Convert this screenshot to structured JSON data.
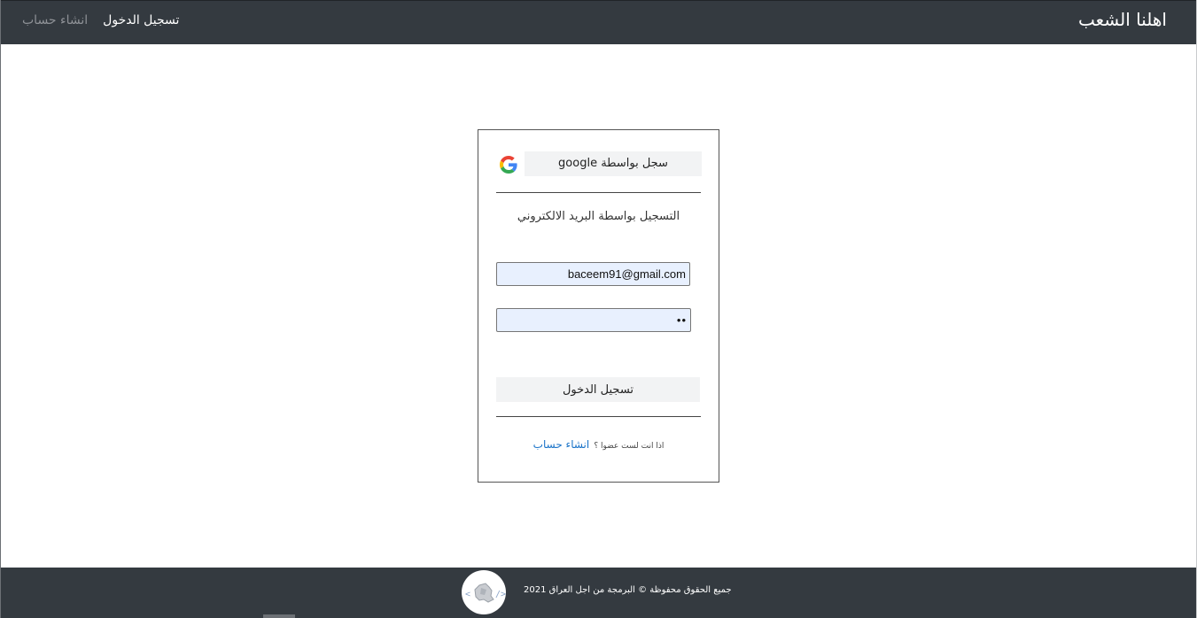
{
  "navbar": {
    "brand": "اهلنا الشعب",
    "links": [
      {
        "label": "تسجيل الدخول",
        "active": true
      },
      {
        "label": "انشاء حساب",
        "active": false
      }
    ]
  },
  "login_card": {
    "google_button_label": "سجل  بواسطة google",
    "google_icon": "google-g-icon",
    "email_section_heading": "التسجيل بواسطة البريد الالكتروني",
    "email_value": "baceem91@gmail.com",
    "password_value": "••",
    "login_button_label": "تسجيل الدخول",
    "signup_prompt": "اذا انت لست عضوا ؟",
    "signup_link": "انشاء حساب"
  },
  "footer": {
    "copyright": "جميع الحقوق محفوظة © البرمجة من اجل العراق 2021",
    "logo_icon": "iraq-map-code-logo"
  },
  "colors": {
    "navbar_bg": "#343a40",
    "input_bg": "#e8f0fe",
    "button_bg": "#f2f3f4",
    "link_blue": "#1a73c8"
  }
}
